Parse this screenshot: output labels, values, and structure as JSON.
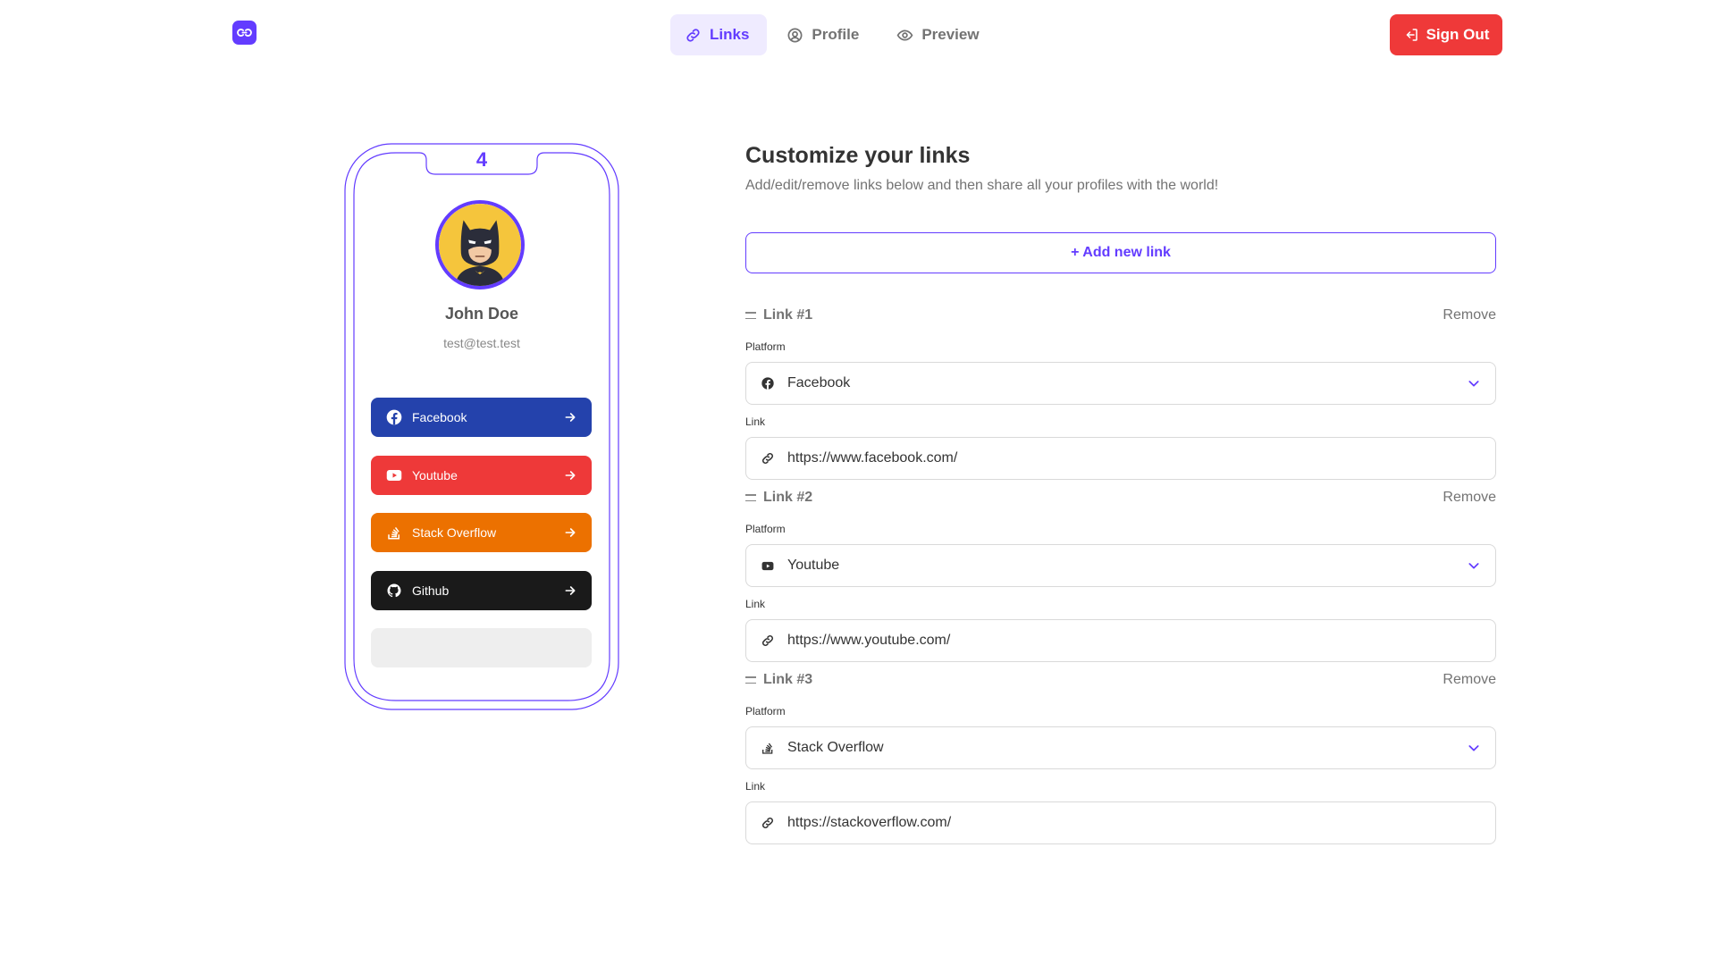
{
  "nav": {
    "tabs": [
      {
        "label": "Links",
        "icon": "link-icon",
        "active": true
      },
      {
        "label": "Profile",
        "icon": "profile-icon",
        "active": false
      },
      {
        "label": "Preview",
        "icon": "eye-icon",
        "active": false
      }
    ],
    "signout_label": "Sign Out"
  },
  "phone": {
    "link_count": "4",
    "name": "John Doe",
    "email": "test@test.test",
    "links": [
      {
        "label": "Facebook",
        "color": "#2442ac",
        "icon": "facebook-icon"
      },
      {
        "label": "Youtube",
        "color": "#ee3939",
        "icon": "youtube-icon"
      },
      {
        "label": "Stack Overflow",
        "color": "#ec7100",
        "icon": "stackoverflow-icon"
      },
      {
        "label": "Github",
        "color": "#1a1a1a",
        "icon": "github-icon"
      }
    ]
  },
  "editor": {
    "title": "Customize your links",
    "subtitle": "Add/edit/remove links below and then share all your profiles with the world!",
    "add_label": "+ Add new link",
    "platform_label": "Platform",
    "link_label": "Link",
    "remove_label": "Remove",
    "links": [
      {
        "title": "Link #1",
        "platform": "Facebook",
        "url": "https://www.facebook.com/"
      },
      {
        "title": "Link #2",
        "platform": "Youtube",
        "url": "https://www.youtube.com/"
      },
      {
        "title": "Link #3",
        "platform": "Stack Overflow",
        "url": "https://stackoverflow.com/"
      }
    ]
  },
  "colors": {
    "accent": "#633cff",
    "danger": "#ef3939"
  }
}
